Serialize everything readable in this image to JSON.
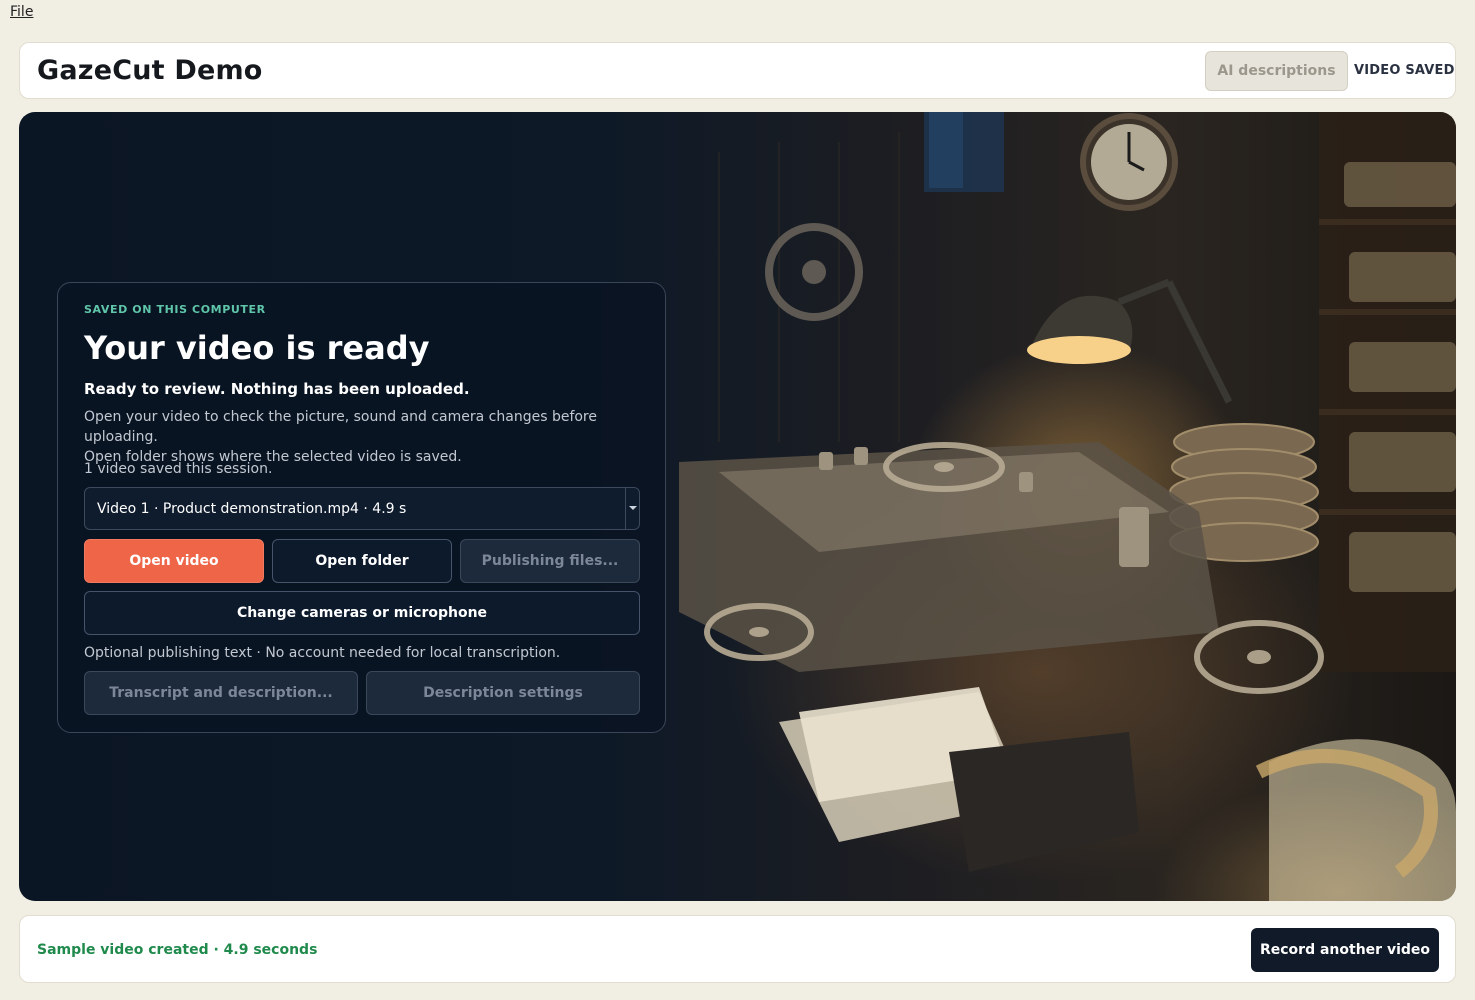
{
  "menubar": {
    "file_label": "File"
  },
  "header": {
    "app_title": "GazeCut Demo",
    "ai_descriptions_label": "AI descriptions",
    "save_status": "VIDEO SAVED"
  },
  "card": {
    "eyebrow": "SAVED ON THIS COMPUTER",
    "title": "Your video is ready",
    "subtitle": "Ready to review. Nothing has been uploaded.",
    "description_line1": "Open your video to check the picture, sound and camera changes before uploading.",
    "description_line2": "Open folder shows where the selected video is saved.",
    "session_count": "1 video saved this session.",
    "video_select_value": "Video 1 · Product demonstration.mp4 · 4.9 s",
    "open_video_label": "Open video",
    "open_folder_label": "Open folder",
    "publishing_files_label": "Publishing files...",
    "change_cameras_label": "Change cameras or microphone",
    "optional_text": "Optional publishing text · No account needed for local transcription.",
    "transcript_label": "Transcript and description...",
    "description_settings_label": "Description settings"
  },
  "footer": {
    "status": "Sample video created · 4.9 seconds",
    "record_another_label": "Record another video"
  },
  "colors": {
    "accent": "#ee6547",
    "eyebrow": "#5fc6a9",
    "success": "#1f8a4c",
    "dark_button": "#111a28"
  }
}
